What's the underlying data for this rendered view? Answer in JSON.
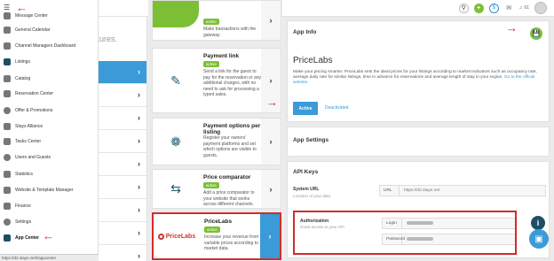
{
  "topbar": {
    "brand": "os",
    "user_count": "61",
    "icons": [
      "search-icon",
      "plus-icon",
      "dollar-icon",
      "message-icon",
      "bell-icon",
      "user-avatar"
    ]
  },
  "sidebar": {
    "items": [
      {
        "label": "Message Center",
        "icon": "message-icon"
      },
      {
        "label": "General Calendar",
        "icon": "calendar-icon"
      },
      {
        "label": "Channel Managers Dashboard",
        "icon": "dashboard-icon"
      },
      {
        "label": "Listings",
        "icon": "home-icon"
      },
      {
        "label": "Catalog",
        "icon": "catalog-icon"
      },
      {
        "label": "Reservation Center",
        "icon": "reservation-icon"
      },
      {
        "label": "Offer & Promotions",
        "icon": "offer-icon"
      },
      {
        "label": "Stays Alliance",
        "icon": "alliance-icon"
      },
      {
        "label": "Tasks Center",
        "icon": "tasks-icon"
      },
      {
        "label": "Users and Guests",
        "icon": "users-icon"
      },
      {
        "label": "Statistics",
        "icon": "statistics-icon"
      },
      {
        "label": "Website & Template Manager",
        "icon": "website-icon"
      },
      {
        "label": "Finance",
        "icon": "finance-icon"
      },
      {
        "label": "Settings",
        "icon": "gear-icon"
      },
      {
        "label": "App Center",
        "icon": "app-center-icon"
      }
    ],
    "status_url": "https://d2.stays.net/i/appcenter"
  },
  "col2": {
    "subtitle": "features.",
    "partial_r": "r"
  },
  "cards": [
    {
      "title": "",
      "badge": "active",
      "desc": "Make transactions with the gateway"
    },
    {
      "title": "Payment link",
      "badge": "active",
      "desc": "Send a link for the guest to pay for the reservation or any additional charges, with no need to ask for processing a typed sales."
    },
    {
      "title": "Payment options per listing",
      "badge": "",
      "desc": "Register your owners' payment platforms and set which options are visible to guests."
    },
    {
      "title": "Price comparator",
      "badge": "active",
      "desc": "Add a price comparator to your website that works across different channels."
    },
    {
      "title": "PriceLabs",
      "badge": "active",
      "desc": "Increase your revenue from variable prices according to market data.",
      "logo": "PriceLabs"
    }
  ],
  "app_info": {
    "header": "App Info",
    "name": "PriceLabs",
    "desc": "Make your pricing smarter. PriceLabs sets the ideal prices for your listings according to market indicators such as occupancy rate, average daily rate for similar listings, time in advance for reservations and average length of stay in your region.",
    "link": "Go to the official website.",
    "active_label": "Active",
    "deactivated_label": "Deactivated"
  },
  "app_settings": {
    "header": "App Settings"
  },
  "api_keys": {
    "header": "API Keys",
    "system_url_label": "System URL",
    "system_url_hint": "Location of your data",
    "url_key": "URL",
    "url_value": "https://d2.stays.net",
    "auth_label": "Authorization",
    "auth_hint": "Grant access to your API",
    "login_key": "Login",
    "password_key": "Password"
  },
  "colors": {
    "accent": "#3a9bd8",
    "green": "#7cbf35",
    "annotation": "#d42b2b"
  }
}
